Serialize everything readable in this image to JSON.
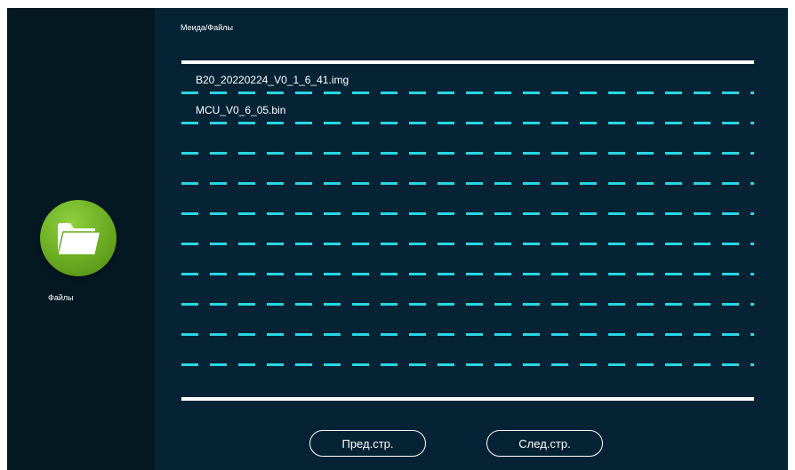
{
  "breadcrumb": "Меида/Файлы",
  "sidebar": {
    "items": [
      {
        "label": "Файлы",
        "icon": "folder-icon"
      }
    ]
  },
  "files": [
    {
      "name": "B20_20220224_V0_1_6_41.img"
    },
    {
      "name": "MCU_V0_6_05.bin"
    },
    {
      "name": ""
    },
    {
      "name": ""
    },
    {
      "name": ""
    },
    {
      "name": ""
    },
    {
      "name": ""
    },
    {
      "name": ""
    },
    {
      "name": ""
    },
    {
      "name": ""
    },
    {
      "name": ""
    }
  ],
  "pagination": {
    "prev_label": "Пред.стр.",
    "next_label": "След.стр."
  },
  "colors": {
    "background": "#062336",
    "sidebar": "#041822",
    "separator": "#27d8e2",
    "folder_green": "#6aab22",
    "text": "#ffffff"
  }
}
